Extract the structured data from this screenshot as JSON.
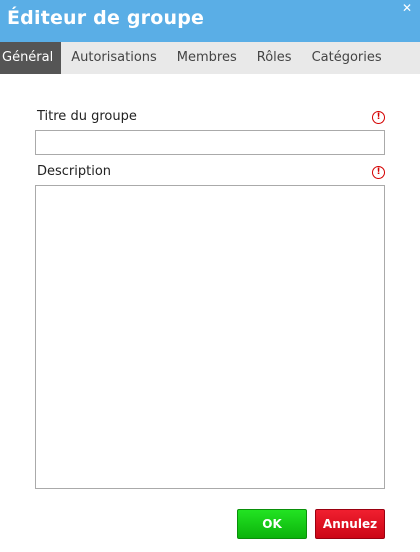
{
  "window": {
    "title": "Éditeur de groupe",
    "close_glyph": "✕"
  },
  "tabs": [
    {
      "label": "Général",
      "active": true
    },
    {
      "label": "Autorisations",
      "active": false
    },
    {
      "label": "Membres",
      "active": false
    },
    {
      "label": "Rôles",
      "active": false
    },
    {
      "label": "Catégories",
      "active": false
    }
  ],
  "form": {
    "group_title_label": "Titre du groupe",
    "group_title_value": "",
    "description_label": "Description",
    "description_value": "",
    "required_glyph": "!"
  },
  "buttons": {
    "ok_label": "OK",
    "cancel_label": "Annulez"
  },
  "colors": {
    "titlebar": "#5aaee6",
    "active_tab": "#555555",
    "ok": "#11c811",
    "cancel": "#e30d1f",
    "required": "#d40000"
  },
  "icons": {
    "close": "close-icon",
    "required": "required-alert-icon"
  }
}
